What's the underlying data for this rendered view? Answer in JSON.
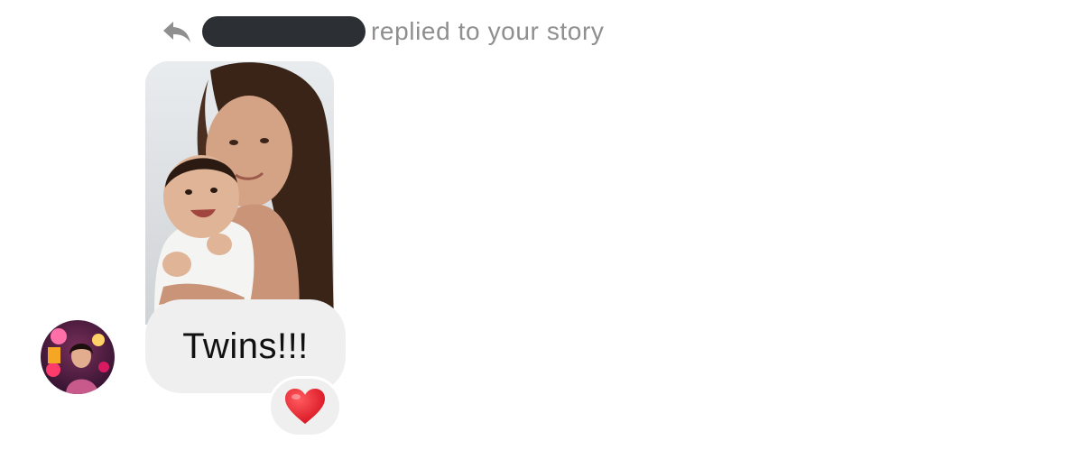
{
  "reply_header": {
    "icon": "reply-arrow-icon",
    "sender_name": "",
    "text": "replied to your story"
  },
  "story": {
    "description_icon": "story-photo"
  },
  "message": {
    "text": "Twins!!!"
  },
  "reaction": {
    "emoji": "❤️",
    "icon": "heart-icon"
  },
  "avatar": {
    "icon": "profile-avatar"
  },
  "colors": {
    "bubble_bg": "#efefef",
    "secondary_text": "#8f8f8f",
    "redaction": "#2c2f33",
    "heart": "#e11d2a"
  }
}
